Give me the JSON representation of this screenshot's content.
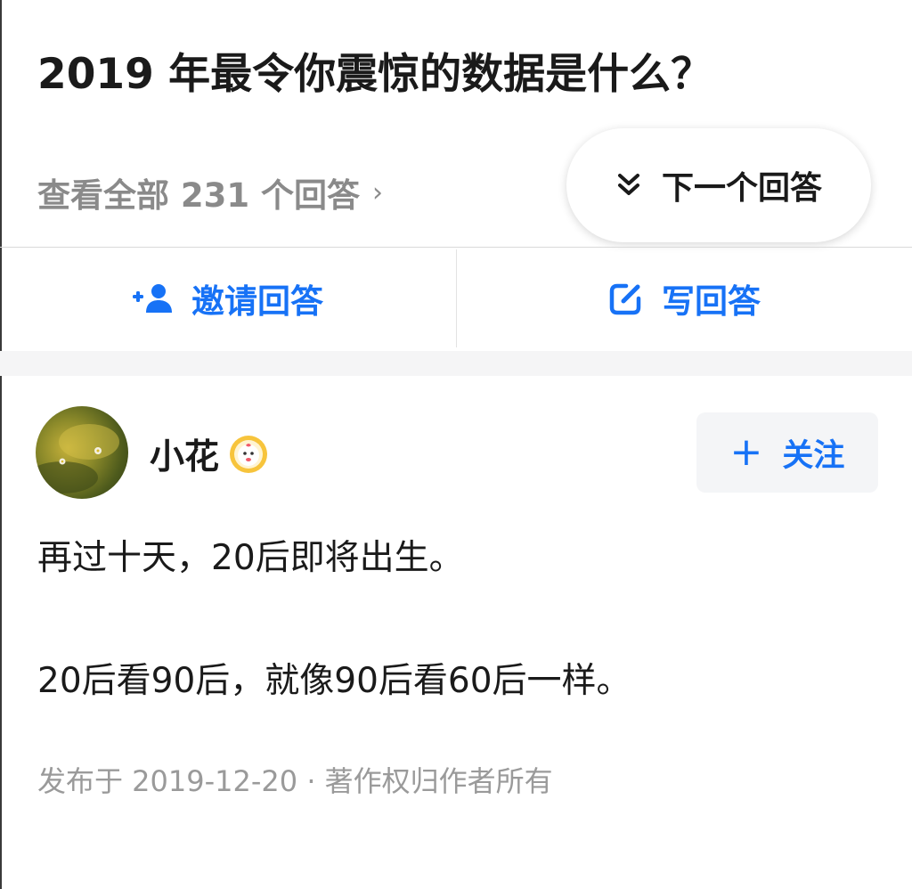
{
  "question": {
    "title": "2019 年最令你震惊的数据是什么？",
    "view_all_label": "查看全部 231 个回答",
    "next_answer_label": "下一个回答"
  },
  "actions": {
    "invite_label": "邀请回答",
    "write_label": "写回答"
  },
  "answer": {
    "author_name": "小花",
    "follow_label": "关注",
    "paragraphs": [
      "再过十天，20后即将出生。",
      "20后看90后，就像90后看60后一样。"
    ],
    "meta": "发布于 2019-12-20 · 著作权归作者所有"
  },
  "colors": {
    "accent": "#1772f6",
    "muted_text": "#8a8a8a"
  },
  "icons": {
    "next": "double-chevron-down-icon",
    "invite": "add-user-icon",
    "write": "edit-icon",
    "badge": "avatar-badge-icon",
    "follow": "plus-icon",
    "view_all": "chevron-right-icon"
  }
}
